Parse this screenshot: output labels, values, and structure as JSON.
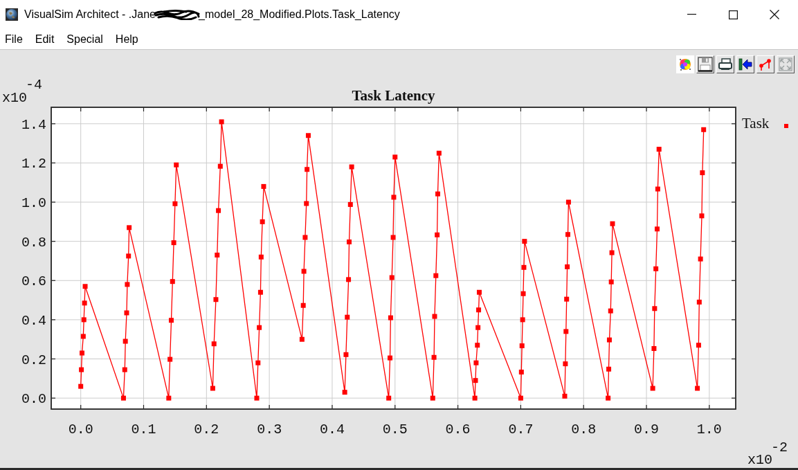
{
  "window": {
    "title_start": "VisualSim Architect - .Jane",
    "title_end": "_model_28_Modified.Plots.Task_Latency"
  },
  "menu": [
    "File",
    "Edit",
    "Special",
    "Help"
  ],
  "plot": {
    "y_multiplier": {
      "base": "x10",
      "exponent": "-4"
    },
    "x_multiplier": {
      "base": "x10",
      "exponent": "-2"
    },
    "chart_data": {
      "type": "line",
      "title": "Task Latency",
      "grid": true,
      "x": [
        0,
        0.001,
        0.002,
        0.004,
        0.005,
        0.006,
        0.007,
        0.068,
        0.07,
        0.071,
        0.073,
        0.074,
        0.076,
        0.077,
        0.14,
        0.142,
        0.144,
        0.146,
        0.148,
        0.15,
        0.152,
        0.21,
        0.212,
        0.215,
        0.217,
        0.219,
        0.222,
        0.224,
        0.28,
        0.282,
        0.284,
        0.286,
        0.287,
        0.289,
        0.291,
        0.352,
        0.354,
        0.355,
        0.357,
        0.359,
        0.36,
        0.362,
        0.42,
        0.422,
        0.424,
        0.426,
        0.427,
        0.429,
        0.431,
        0.49,
        0.492,
        0.493,
        0.495,
        0.497,
        0.498,
        0.5,
        0.56,
        0.562,
        0.563,
        0.565,
        0.567,
        0.568,
        0.57,
        0.627,
        0.628,
        0.629,
        0.631,
        0.632,
        0.633,
        0.634,
        0.7,
        0.701,
        0.702,
        0.703,
        0.704,
        0.705,
        0.706,
        0.77,
        0.771,
        0.772,
        0.773,
        0.774,
        0.775,
        0.776,
        0.839,
        0.84,
        0.841,
        0.843,
        0.844,
        0.845,
        0.846,
        0.91,
        0.912,
        0.913,
        0.915,
        0.917,
        0.918,
        0.92,
        0.981,
        0.983,
        0.984,
        0.986,
        0.988,
        0.989,
        0.991
      ],
      "series": [
        {
          "name": "Task",
          "color": "#ff0000",
          "marker": "square",
          "values": [
            0.06,
            0.145,
            0.23,
            0.315,
            0.4,
            0.485,
            0.57,
            0,
            0.145,
            0.29,
            0.435,
            0.58,
            0.725,
            0.87,
            0,
            0.198,
            0.397,
            0.595,
            0.793,
            0.992,
            1.19,
            0.05,
            0.277,
            0.503,
            0.73,
            0.957,
            1.183,
            1.41,
            0,
            0.18,
            0.36,
            0.54,
            0.72,
            0.9,
            1.08,
            0.3,
            0.473,
            0.647,
            0.82,
            0.993,
            1.167,
            1.34,
            0.03,
            0.222,
            0.413,
            0.605,
            0.797,
            0.988,
            1.18,
            0,
            0.205,
            0.41,
            0.615,
            0.82,
            1.025,
            1.23,
            0,
            0.208,
            0.417,
            0.625,
            0.833,
            1.042,
            1.25,
            0,
            0.09,
            0.18,
            0.27,
            0.36,
            0.45,
            0.54,
            0,
            0.133,
            0.267,
            0.4,
            0.533,
            0.667,
            0.8,
            0.01,
            0.175,
            0.34,
            0.505,
            0.67,
            0.835,
            1,
            0,
            0.148,
            0.297,
            0.445,
            0.593,
            0.742,
            0.89,
            0.05,
            0.253,
            0.457,
            0.66,
            0.863,
            1.067,
            1.27,
            0.05,
            0.27,
            0.49,
            0.71,
            0.93,
            1.15,
            1.37
          ]
        }
      ],
      "xlim": [
        -0.047,
        1.042
      ],
      "ylim": [
        -0.056,
        1.484
      ],
      "xticks": [
        {
          "value": 0,
          "label": "0.0"
        },
        {
          "value": 0.1,
          "label": "0.1"
        },
        {
          "value": 0.2,
          "label": "0.2"
        },
        {
          "value": 0.3,
          "label": "0.3"
        },
        {
          "value": 0.4,
          "label": "0.4"
        },
        {
          "value": 0.5,
          "label": "0.5"
        },
        {
          "value": 0.6,
          "label": "0.6"
        },
        {
          "value": 0.7,
          "label": "0.7"
        },
        {
          "value": 0.8,
          "label": "0.8"
        },
        {
          "value": 0.9,
          "label": "0.9"
        },
        {
          "value": 1,
          "label": "1.0"
        }
      ],
      "yticks": [
        {
          "value": 0,
          "label": "0.0"
        },
        {
          "value": 0.2,
          "label": "0.2"
        },
        {
          "value": 0.4,
          "label": "0.4"
        },
        {
          "value": 0.6,
          "label": "0.6"
        },
        {
          "value": 0.8,
          "label": "0.8"
        },
        {
          "value": 1,
          "label": "1.0"
        },
        {
          "value": 1.2,
          "label": "1.2"
        },
        {
          "value": 1.4,
          "label": "1.4"
        }
      ]
    }
  }
}
